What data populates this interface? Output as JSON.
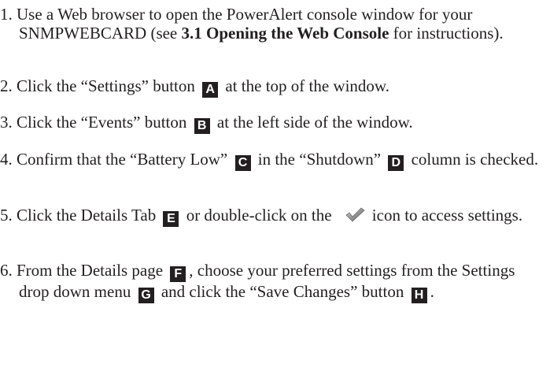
{
  "steps": [
    {
      "num": "1.",
      "t1": "Use a Web browser to open the PowerAlert console window for your SNMPWEBCARD (see ",
      "bold": "3.1 Opening the Web Console",
      "t2": " for instructions)."
    },
    {
      "num": "2.",
      "t1": "Click the “Settings” button ",
      "badge": "A",
      "t2": " at the top of the window."
    },
    {
      "num": "3.",
      "t1": "Click the “Events” button ",
      "badge": "B",
      "t2": " at the left side of the window."
    },
    {
      "num": "4.",
      "t1": "Confirm that the “Battery Low” ",
      "badge1": "C",
      "t2": " in the “Shutdown” ",
      "badge2": "D",
      "t3": " column is checked."
    },
    {
      "num": "5.",
      "t1": "Click the Details Tab ",
      "badge": "E",
      "t2": " or double-click on the ",
      "icon": "checkmark-icon",
      "t3": "icon to access settings."
    },
    {
      "num": "6.",
      "t1": "From the Details page ",
      "badge1": "F",
      "t2": ", choose your preferred settings from the Settings drop down menu ",
      "badge2": "G",
      "t3": " and click the “Save Changes” button ",
      "badge3": "H",
      "t4": "."
    }
  ]
}
